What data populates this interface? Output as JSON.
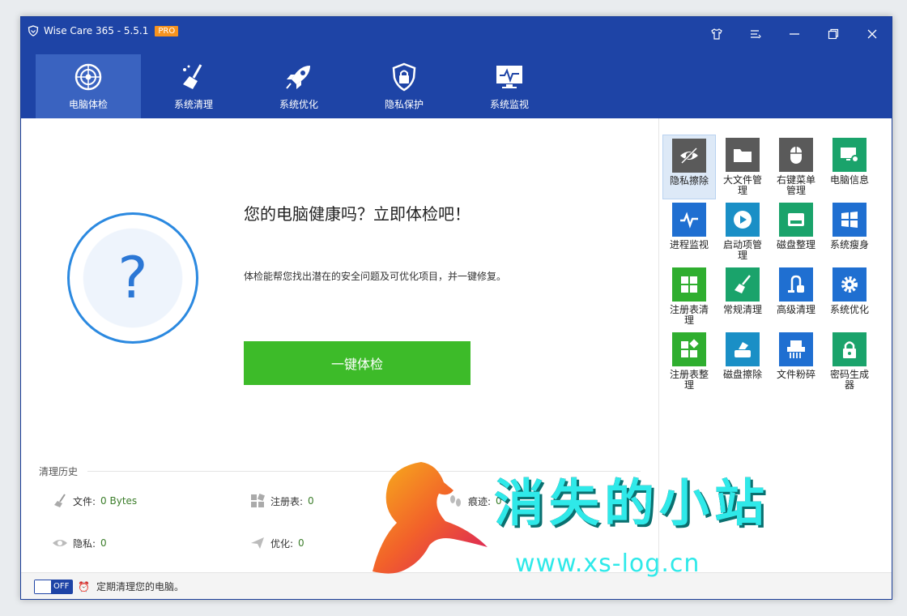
{
  "window": {
    "title": "Wise Care 365 - 5.5.1",
    "badge": "PRO"
  },
  "nav": [
    {
      "label": "电脑体检",
      "icon": "radar-icon"
    },
    {
      "label": "系统清理",
      "icon": "broom-icon"
    },
    {
      "label": "系统优化",
      "icon": "rocket-icon"
    },
    {
      "label": "隐私保护",
      "icon": "lock-shield-icon"
    },
    {
      "label": "系统监视",
      "icon": "monitor-pulse-icon"
    }
  ],
  "main": {
    "headline": "您的电脑健康吗？立即体检吧！",
    "description": "体检能帮您找出潜在的安全问题及可优化项目，并一键修复。",
    "scan_button": "一键体检",
    "circle_glyph": "?"
  },
  "history": {
    "title": "清理历史",
    "file_label": "文件:",
    "file_value": "0 Bytes",
    "registry_label": "注册表:",
    "registry_value": "0",
    "trace_label": "痕迹:",
    "trace_value": "0",
    "privacy_label": "隐私:",
    "privacy_value": "0",
    "optimize_label": "优化:",
    "optimize_value": "0"
  },
  "footer": {
    "toggle": "OFF",
    "text": "定期清理您的电脑。"
  },
  "tools": [
    {
      "name": "隐私擦除",
      "color": "#5a5a5a",
      "icon": "eye-slash-icon"
    },
    {
      "name": "大文件管理",
      "color": "#5a5a5a",
      "icon": "folder-icon"
    },
    {
      "name": "右键菜单管理",
      "color": "#5a5a5a",
      "icon": "mouse-icon"
    },
    {
      "name": "电脑信息",
      "color": "#1aa36b",
      "icon": "pc-gear-icon"
    },
    {
      "name": "进程监视",
      "color": "#1f6fd1",
      "icon": "pulse-icon"
    },
    {
      "name": "启动项管理",
      "color": "#1a8fc6",
      "icon": "play-icon"
    },
    {
      "name": "磁盘整理",
      "color": "#1aa36b",
      "icon": "disk-icon"
    },
    {
      "name": "系统瘦身",
      "color": "#1f6fd1",
      "icon": "windows-icon"
    },
    {
      "name": "注册表清理",
      "color": "#2fae2f",
      "icon": "grid-icon"
    },
    {
      "name": "常规清理",
      "color": "#1aa36b",
      "icon": "broom-icon"
    },
    {
      "name": "高级清理",
      "color": "#1f6fd1",
      "icon": "vacuum-icon"
    },
    {
      "name": "系统优化",
      "color": "#1f6fd1",
      "icon": "gear-icon"
    },
    {
      "name": "注册表整理",
      "color": "#2fae2f",
      "icon": "blocks-icon"
    },
    {
      "name": "磁盘擦除",
      "color": "#1a8fc6",
      "icon": "disk-eraser-icon"
    },
    {
      "name": "文件粉碎",
      "color": "#1f6fd1",
      "icon": "shredder-icon"
    },
    {
      "name": "密码生成器",
      "color": "#1aa36b",
      "icon": "padlock-icon"
    }
  ],
  "watermark": {
    "text": "消失的小站",
    "url": "www.xs-log.cn"
  }
}
